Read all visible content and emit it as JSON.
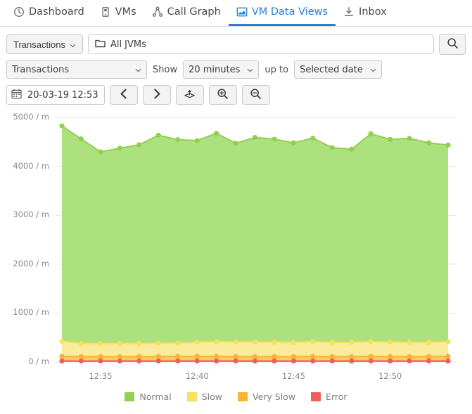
{
  "tabs": [
    {
      "label": "Dashboard",
      "icon": "clock-icon",
      "active": false
    },
    {
      "label": "VMs",
      "icon": "server-icon",
      "active": false
    },
    {
      "label": "Call Graph",
      "icon": "call-graph-icon",
      "active": false
    },
    {
      "label": "VM Data Views",
      "icon": "chart-icon",
      "active": true
    },
    {
      "label": "Inbox",
      "icon": "inbox-icon",
      "active": false
    }
  ],
  "toolbar": {
    "scope_button": "Transactions",
    "search_value": "All JVMs",
    "search_placeholder": "All JVMs",
    "search_button_icon": "search-icon",
    "folder_icon": "folder-icon"
  },
  "filters": {
    "metric": "Transactions",
    "show_label": "Show",
    "range": "20 minutes",
    "upto_label": "up to",
    "upto": "Selected date"
  },
  "daterow": {
    "calendar_icon": "calendar-icon",
    "date_value": "20-03-19 12:53",
    "prev_icon": "chevron-left-icon",
    "next_icon": "chevron-right-icon",
    "export_icon": "upload-icon",
    "zoom_in_icon": "zoom-in-icon",
    "zoom_out_icon": "zoom-out-icon"
  },
  "colors": {
    "accent": "#2a7dd1",
    "normal": "#92d050",
    "normal_fill": "#ade17e",
    "slow": "#f7e05c",
    "slow_fill": "#fbeb9c",
    "very_slow": "#fab333",
    "very_slow_fill": "#fcc86a",
    "error": "#ef5e5e",
    "error_fill": "#f5908a",
    "grid": "#e2e2e2",
    "axis_text": "#8a8a8a"
  },
  "chart_data": {
    "type": "area",
    "stacked": true,
    "title": "",
    "xlabel": "",
    "ylabel": "",
    "ylim": [
      0,
      5000
    ],
    "yticks": [
      0,
      1000,
      2000,
      3000,
      4000,
      5000
    ],
    "ytick_labels": [
      "0 / m",
      "1000 / m",
      "2000 / m",
      "3000 / m",
      "4000 / m",
      "5000 / m"
    ],
    "grid": true,
    "legend_position": "bottom",
    "x": [
      "12:33",
      "12:34",
      "12:35",
      "12:36",
      "12:37",
      "12:38",
      "12:39",
      "12:40",
      "12:41",
      "12:42",
      "12:43",
      "12:44",
      "12:45",
      "12:46",
      "12:47",
      "12:48",
      "12:49",
      "12:50",
      "12:51",
      "12:52",
      "12:53"
    ],
    "xtick_labels": [
      "12:35",
      "12:40",
      "12:45",
      "12:50"
    ],
    "xtick_positions": [
      2,
      7,
      12,
      17
    ],
    "series": [
      {
        "name": "Normal",
        "color": "#92d050",
        "fill": "#ade17e",
        "values": [
          4400,
          4180,
          3920,
          3990,
          4060,
          4250,
          4160,
          4120,
          4260,
          4060,
          4180,
          4150,
          4080,
          4160,
          3980,
          3950,
          4250,
          4140,
          4170,
          4080,
          4020
        ]
      },
      {
        "name": "Slow",
        "color": "#f7e05c",
        "fill": "#fbeb9c",
        "values": [
          310,
          270,
          265,
          270,
          270,
          275,
          270,
          290,
          300,
          300,
          300,
          295,
          290,
          300,
          290,
          290,
          300,
          300,
          290,
          290,
          300
        ]
      },
      {
        "name": "Very Slow",
        "color": "#fab333",
        "fill": "#fcc86a",
        "values": [
          95,
          90,
          90,
          90,
          90,
          90,
          95,
          95,
          95,
          90,
          90,
          90,
          90,
          95,
          90,
          90,
          95,
          90,
          90,
          90,
          95
        ]
      },
      {
        "name": "Error",
        "color": "#ef5e5e",
        "fill": "#f5908a",
        "values": [
          20,
          20,
          20,
          20,
          20,
          20,
          20,
          20,
          20,
          20,
          20,
          20,
          20,
          20,
          20,
          20,
          20,
          20,
          20,
          20,
          20
        ]
      }
    ]
  },
  "legend": [
    {
      "label": "Normal",
      "color": "#92d050"
    },
    {
      "label": "Slow",
      "color": "#f7e05c"
    },
    {
      "label": "Very Slow",
      "color": "#fab333"
    },
    {
      "label": "Error",
      "color": "#ef5e5e"
    }
  ]
}
